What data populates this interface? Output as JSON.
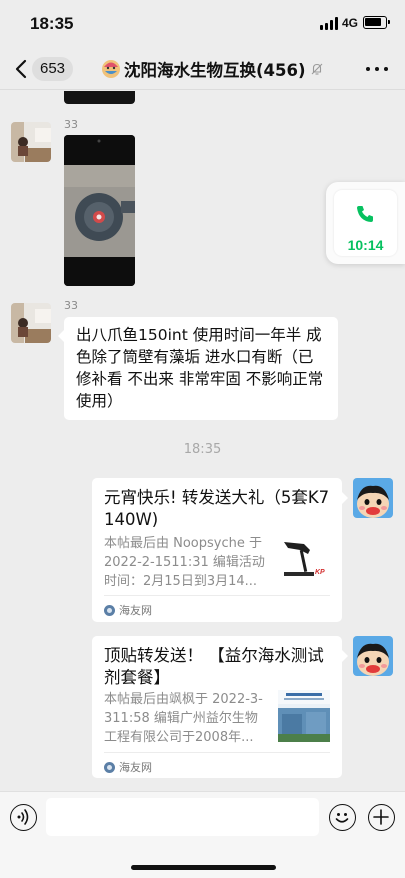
{
  "status_bar": {
    "time": "18:35",
    "network": "4G"
  },
  "nav": {
    "unread_count": "653",
    "title": "沈阳海水生物互换(456)"
  },
  "messages": [
    {
      "sender": "33",
      "type": "video"
    },
    {
      "sender": "33",
      "type": "text",
      "text": "出八爪鱼150int 使用时间一年半 成色除了筒壁有藻垢 进水口有断（已修补看 不出来 非常牢固 不影响正常使用）"
    }
  ],
  "timestamp": "18:35",
  "link_cards": [
    {
      "title": "元宵快乐! 转发送大礼（5套K7  140W)",
      "desc": "本帖最后由 Noopsyche 于 2022-2-1511:31 编辑活动时间：2月15日到3月14...",
      "source": "海友网",
      "thumb_label": "KP"
    },
    {
      "title": "顶贴转发送！ 【益尔海水测试剂套餐】",
      "desc": "本帖最后由飒枫于 2022-3-311:58 编辑广州益尔生物工程有限公司于2008年...",
      "source": "海友网"
    }
  ],
  "floating_call": {
    "duration": "10:14"
  },
  "colors": {
    "accent": "#07c160",
    "chat_bg": "#ededed",
    "bubble": "#ffffff"
  }
}
